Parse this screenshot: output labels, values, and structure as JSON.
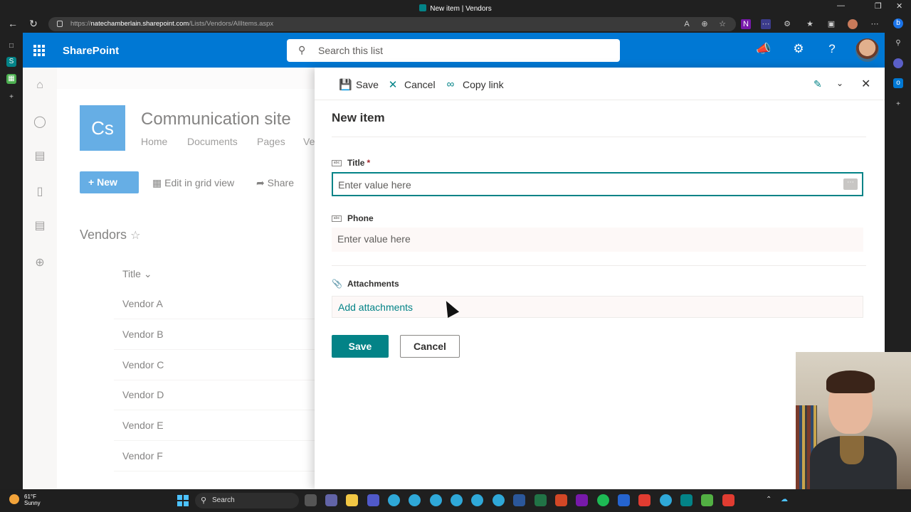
{
  "browser": {
    "tab_title": "New item | Vendors",
    "url_prefix": "https://",
    "url_host": "natechamberlain.sharepoint.com",
    "url_path": "/Lists/Vendors/AllItems.aspx"
  },
  "suite": {
    "brand": "SharePoint",
    "search_placeholder": "Search this list"
  },
  "site": {
    "logo_initials": "Cs",
    "title": "Communication site",
    "nav": [
      "Home",
      "Documents",
      "Pages",
      "Ve"
    ]
  },
  "commands": {
    "new_label": "New",
    "grid_label": "Edit in grid view",
    "share_label": "Share"
  },
  "list": {
    "title": "Vendors",
    "column_header": "Title",
    "rows": [
      "Vendor A",
      "Vendor B",
      "Vendor C",
      "Vendor D",
      "Vendor E",
      "Vendor F"
    ]
  },
  "panel": {
    "toolbar": {
      "save_label": "Save",
      "cancel_label": "Cancel",
      "copylink_label": "Copy link"
    },
    "heading": "New item",
    "fields": {
      "title_label": "Title",
      "title_required_mark": "*",
      "title_placeholder": "Enter value here",
      "phone_label": "Phone",
      "phone_placeholder": "Enter value here",
      "attachments_label": "Attachments",
      "add_attachments_label": "Add attachments"
    },
    "footer": {
      "save_label": "Save",
      "cancel_label": "Cancel"
    }
  },
  "taskbar": {
    "temperature": "61°F",
    "condition": "Sunny",
    "search_label": "Search"
  },
  "colors": {
    "suite_blue": "#0078d4",
    "teal_accent": "#038387",
    "required_red": "#a4262c"
  }
}
